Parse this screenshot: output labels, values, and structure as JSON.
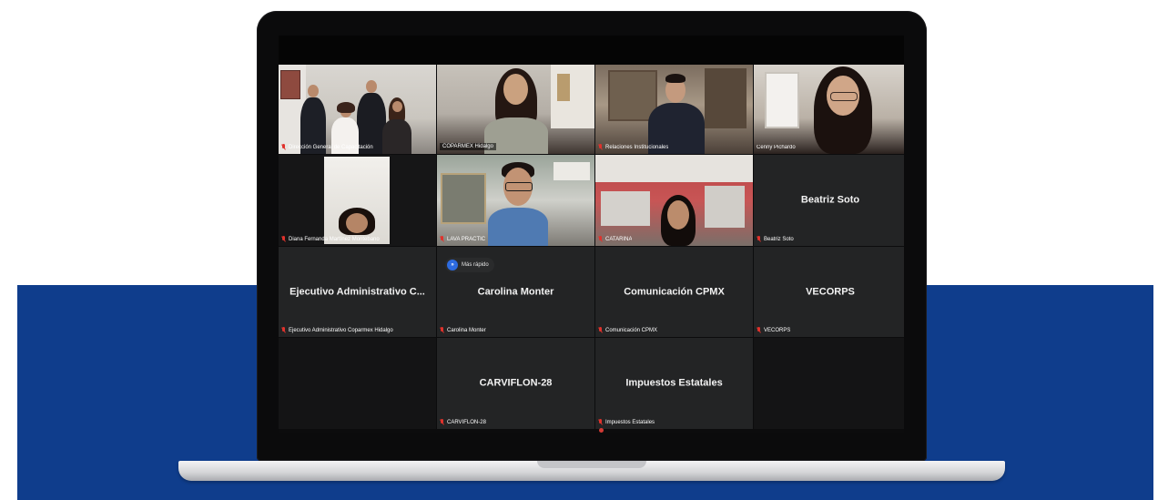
{
  "meeting": {
    "speed_chip": {
      "icon": "fast-forward-icon",
      "label": "Más rápido"
    },
    "tiles": [
      {
        "id": "t1",
        "label": "Dirección General de Capacitación",
        "center": "",
        "video": "group",
        "muted": true
      },
      {
        "id": "t2",
        "label": "COPARMEX Hidalgo",
        "center": "",
        "video": "woman-active",
        "muted": false
      },
      {
        "id": "t3",
        "label": "Relaciones Institucionales",
        "center": "",
        "video": "man-office",
        "muted": true
      },
      {
        "id": "t4",
        "label": "Cenny Pichardo",
        "center": "",
        "video": "woman-smile",
        "muted": false
      },
      {
        "id": "t5",
        "label": "Diana Fernanda Martínez Montebano",
        "center": "",
        "video": "woman-room",
        "muted": true
      },
      {
        "id": "t6",
        "label": "LAVA PRACTIC",
        "center": "",
        "video": "man-glasses",
        "muted": true
      },
      {
        "id": "t7",
        "label": "CATARINA",
        "center": "",
        "video": "woman-red",
        "muted": true
      },
      {
        "id": "t8",
        "label": "Beatriz Soto",
        "center": "Beatriz Soto",
        "video": "none",
        "muted": true
      },
      {
        "id": "t9",
        "label": "Ejecutivo Administrativo Coparmex Hidalgo",
        "center": "Ejecutivo Administrativo C...",
        "video": "none",
        "muted": true
      },
      {
        "id": "t10",
        "label": "Carolina Monter",
        "center": "Carolina Monter",
        "video": "none",
        "muted": true
      },
      {
        "id": "t11",
        "label": "Comunicación CPMX",
        "center": "Comunicación CPMX",
        "video": "none",
        "muted": true
      },
      {
        "id": "t12",
        "label": "VECORPS",
        "center": "VECORPS",
        "video": "none",
        "muted": true
      },
      {
        "id": "t13",
        "label": "",
        "center": "",
        "video": "empty",
        "muted": false
      },
      {
        "id": "t14",
        "label": "CARVIFLON-28",
        "center": "CARVIFLON-28",
        "video": "none",
        "muted": true
      },
      {
        "id": "t15",
        "label": "Impuestos Estatales",
        "center": "Impuestos Estatales",
        "video": "none",
        "muted": true
      },
      {
        "id": "t16",
        "label": "",
        "center": "",
        "video": "empty",
        "muted": false
      }
    ]
  },
  "colors": {
    "brand_band": "#0f3d8c",
    "active_speaker_border": "#c6e06a",
    "mute_icon": "#e0322c",
    "tile_bg": "#232425"
  }
}
